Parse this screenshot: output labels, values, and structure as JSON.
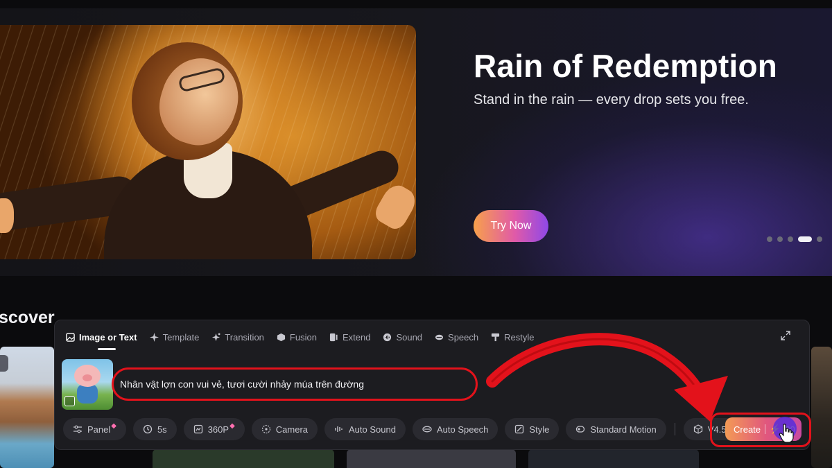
{
  "hero": {
    "title": "Rain of Redemption",
    "subtitle": "Stand in the rain — every drop sets you free.",
    "cta_label": "Try Now",
    "carousel_pages": 5,
    "carousel_active_index": 3
  },
  "discover": {
    "heading": "scover"
  },
  "panel": {
    "tabs": [
      {
        "label": "Image or Text",
        "icon": "image-icon",
        "active": true
      },
      {
        "label": "Template",
        "icon": "sparkle-icon",
        "active": false
      },
      {
        "label": "Transition",
        "icon": "star-icon",
        "active": false
      },
      {
        "label": "Fusion",
        "icon": "cube-icon",
        "active": false
      },
      {
        "label": "Extend",
        "icon": "extend-icon",
        "active": false
      },
      {
        "label": "Sound",
        "icon": "sound-icon",
        "active": false
      },
      {
        "label": "Speech",
        "icon": "speech-icon",
        "active": false
      },
      {
        "label": "Restyle",
        "icon": "brush-icon",
        "active": false
      }
    ],
    "prompt": "Nhân vật lợn con vui vẻ, tươi cười nhảy múa trên đường",
    "toolbar": [
      {
        "label": "Panel",
        "icon": "sliders-icon",
        "premium": true
      },
      {
        "label": "5s",
        "icon": "clock-icon",
        "premium": false
      },
      {
        "label": "360P",
        "icon": "resolution-icon",
        "premium": true
      },
      {
        "label": "Camera",
        "icon": "camera-icon",
        "premium": false
      },
      {
        "label": "Auto Sound",
        "icon": "waveform-icon",
        "premium": false
      },
      {
        "label": "Auto Speech",
        "icon": "speech-icon",
        "premium": false
      },
      {
        "label": "Style",
        "icon": "style-icon",
        "premium": false
      },
      {
        "label": "Standard Motion",
        "icon": "motion-icon",
        "premium": false
      }
    ],
    "model": {
      "label": "V4.5",
      "icon": "cube-icon"
    },
    "create": {
      "label": "Create",
      "credits": "20",
      "credit_icon": "bolt-icon"
    }
  },
  "colors": {
    "accent_start": "#f7a04b",
    "accent_mid": "#e05aa8",
    "accent_end": "#8f48e8",
    "annotation_red": "#e3121b"
  }
}
